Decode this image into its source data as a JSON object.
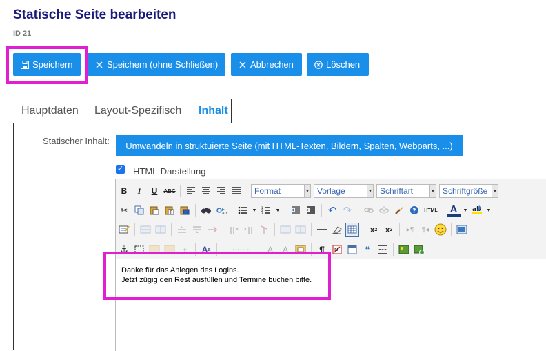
{
  "header": {
    "title": "Statische Seite bearbeiten",
    "id_label": "ID 21"
  },
  "toolbar": {
    "save_label": "Speichern",
    "save_no_close_label": "Speichern (ohne Schließen)",
    "cancel_label": "Abbrechen",
    "delete_label": "Löschen"
  },
  "tabs": [
    {
      "label": "Hauptdaten",
      "active": false
    },
    {
      "label": "Layout-Spezifisch",
      "active": false
    },
    {
      "label": "Inhalt",
      "active": true
    }
  ],
  "content": {
    "field_label": "Statischer Inhalt:",
    "convert_button": "Umwandeln in struktuierte Seite (mit HTML-Texten, Bildern, Spalten, Webparts, ...)",
    "html_view_label": "HTML-Darstellung",
    "html_view_checked": true
  },
  "editor": {
    "combos": {
      "format": "Format",
      "style": "Vorlage",
      "font": "Schriftart",
      "size": "Schriftgröße"
    },
    "source_label": "HTML",
    "lines": [
      "Danke für das Anlegen des Logins.",
      "Jetzt zügig den Rest ausfüllen und Termine buchen bitte."
    ]
  },
  "colors": {
    "primary": "#1a8fea",
    "highlight": "#e020d0",
    "title": "#1a1a7a"
  }
}
